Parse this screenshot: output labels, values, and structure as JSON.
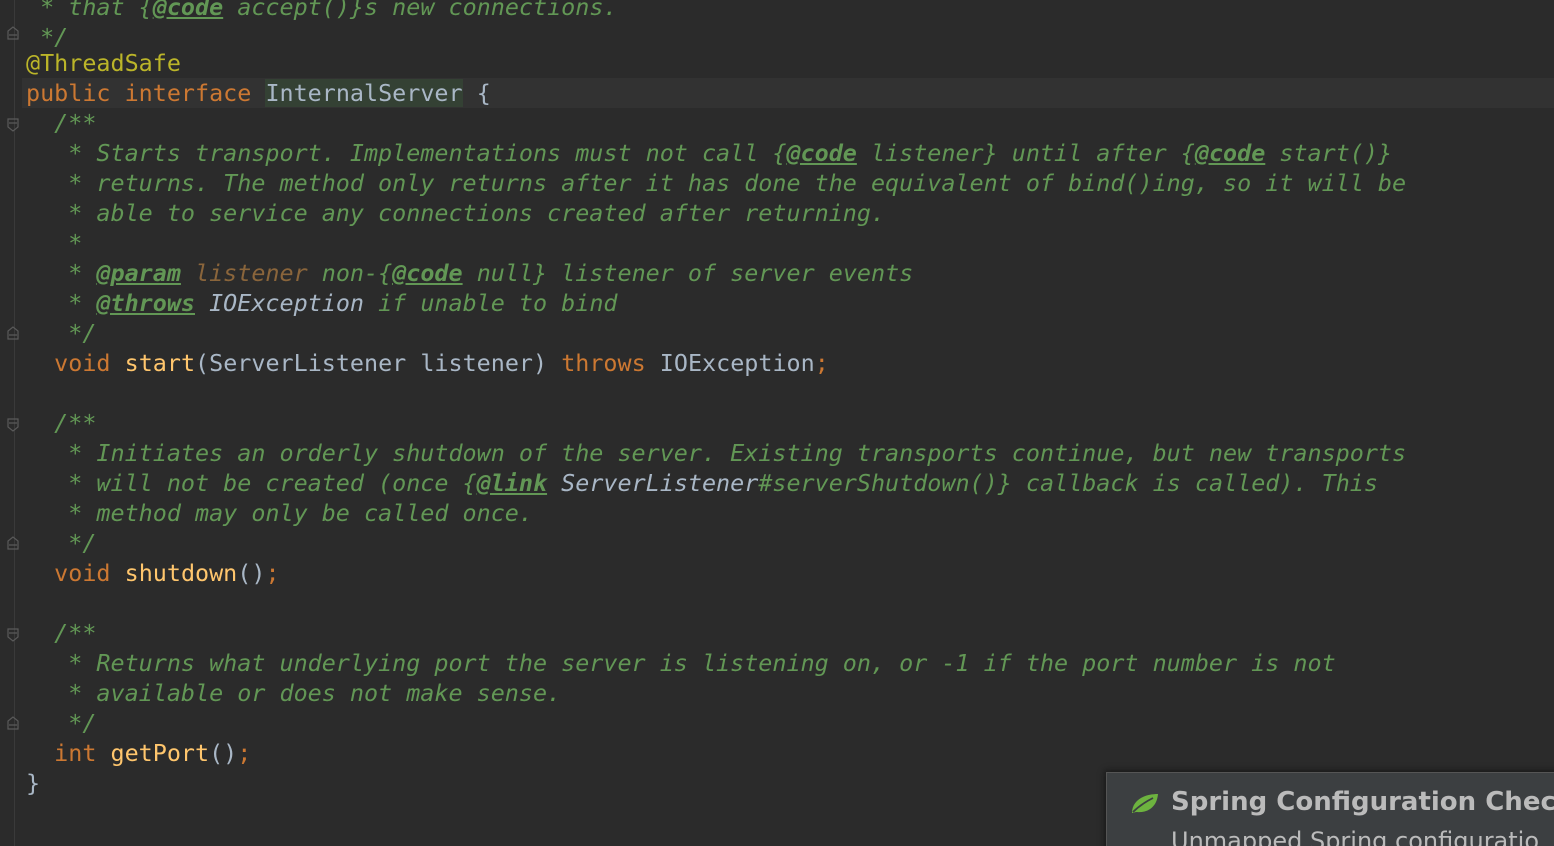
{
  "editor": {
    "lines": {
      "l0": {
        "c1": " * that {",
        "tag": "@code",
        "c2": " accept()}s new connections."
      },
      "l1": {
        "c1": " */"
      },
      "l2": {
        "ann": "@ThreadSafe"
      },
      "l3": {
        "kw1": "public",
        "kw2": "interface",
        "name": "InternalServer",
        "brace": "{"
      },
      "l4": {
        "c1": "  /**"
      },
      "l5": {
        "c1": "   * Starts transport. Implementations must not call {",
        "tag1": "@code",
        "c2": " listener} until after {",
        "tag2": "@code",
        "c3": " start()}"
      },
      "l6": {
        "c1": "   * returns. The method only returns after it has done the equivalent of bind()ing, so it will be"
      },
      "l7": {
        "c1": "   * able to service any connections created after returning."
      },
      "l8": {
        "c1": "   *"
      },
      "l9": {
        "c1": "   * ",
        "tag1": "@param",
        "pname": "listener",
        "c2": " non-{",
        "tag2": "@code",
        "c3": " null} listener of server events"
      },
      "l10": {
        "c1": "   * ",
        "tag1": "@throws",
        "cref": "IOException",
        "c2": " if unable to bind"
      },
      "l11": {
        "c1": "   */"
      },
      "l12": {
        "kw1": "void",
        "fn": "start",
        "p1": "(ServerListener listener) ",
        "kw2": "throws",
        "p2": "IOException",
        "semi": ";"
      },
      "l14": {
        "c1": "  /**"
      },
      "l15": {
        "c1": "   * Initiates an orderly shutdown of the server. Existing transports continue, but new transports"
      },
      "l16": {
        "c1": "   * will not be created (once {",
        "tag1": "@link",
        "cref": "ServerListener",
        "c2": "#serverShutdown()} callback is called). This"
      },
      "l17": {
        "c1": "   * method may only be called once."
      },
      "l18": {
        "c1": "   */"
      },
      "l19": {
        "kw1": "void",
        "fn": "shutdown",
        "p1": "()",
        "semi": ";"
      },
      "l21": {
        "c1": "  /**"
      },
      "l22": {
        "c1": "   * Returns what underlying port the server is listening on, or -1 if the port number is not"
      },
      "l23": {
        "c1": "   * available or does not make sense."
      },
      "l24": {
        "c1": "   */"
      },
      "l25": {
        "kw1": "int",
        "fn": "getPort",
        "p1": "()",
        "semi": ";"
      },
      "l26": {
        "brace": "}"
      }
    }
  },
  "notification": {
    "title": "Spring Configuration Check",
    "body": "Unmapped Spring configuratio",
    "icon": "spring-leaf-icon",
    "accent": "#6db33f"
  },
  "colors": {
    "background": "#2b2b2b",
    "comment": "#629755",
    "keyword": "#cc7832",
    "annotation": "#bbb529",
    "method": "#ffc66d",
    "text": "#a9b7c6"
  }
}
